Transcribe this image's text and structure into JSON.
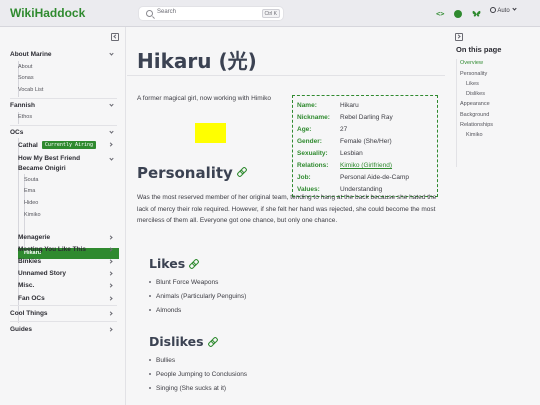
{
  "header": {
    "brand": "WikiHaddock",
    "search_placeholder": "Search",
    "search_shortcut": "Ctrl K",
    "theme_label": "Auto"
  },
  "sidebar": {
    "sections": [
      {
        "label": "About Marine",
        "items": [
          "About",
          "Sonas",
          "Vocab List"
        ]
      },
      {
        "label": "Fannish",
        "items": [
          "Ethos"
        ]
      },
      {
        "label": "OCs"
      }
    ],
    "ocs": {
      "cathal": "Cathal",
      "cathal_badge": "Currently Airing",
      "onigiri": "How My Best Friend Became Onigiri",
      "onigiri_items": [
        "Souta",
        "Ema",
        "Hideo",
        "Kimiko",
        "Hikaru"
      ],
      "more": [
        "Menagerie",
        "Meeting You Like This",
        "Binkies",
        "Unnamed Story",
        "Misc.",
        "Fan OCs"
      ]
    },
    "bottom": [
      "Cool Things",
      "Guides"
    ]
  },
  "article": {
    "title": "Hikaru (光)",
    "intro": "A former magical girl, now working with Himiko",
    "infobox": [
      {
        "key": "Name:",
        "value": "Hikaru"
      },
      {
        "key": "Nickname:",
        "value": "Rebel Darling Ray"
      },
      {
        "key": "Age:",
        "value": "27"
      },
      {
        "key": "Gender:",
        "value": "Female (She/Her)"
      },
      {
        "key": "Sexuality:",
        "value": "Lesbian"
      },
      {
        "key": "Relations:",
        "value": "Kimiko (Girlfriend)"
      },
      {
        "key": "Job:",
        "value": "Personal Aide-de-Camp"
      },
      {
        "key": "Values:",
        "value": "Understanding"
      }
    ],
    "personality_heading": "Personality",
    "personality_text": "Was the most reserved member of her original team, tending to hang at the back because she hated the lack of mercy their role required. However, if she felt her hand was rejected, she could become the most merciless of them all. Everyone got one chance, but only one chance.",
    "likes_heading": "Likes",
    "likes": [
      "Blunt Force Weapons",
      "Animals (Particularly Penguins)",
      "Almonds"
    ],
    "dislikes_heading": "Dislikes",
    "dislikes": [
      "Bullies",
      "People Jumping to Conclusions",
      "Singing (She sucks at it)"
    ]
  },
  "toc": {
    "title": "On this page",
    "items": [
      "Overview",
      "Personality",
      "Likes",
      "Dislikes",
      "Appearance",
      "Background",
      "Relationships",
      "Kimiko"
    ]
  },
  "colors": {
    "accent": "#2f8a2f",
    "highlight": "#ffff00"
  }
}
